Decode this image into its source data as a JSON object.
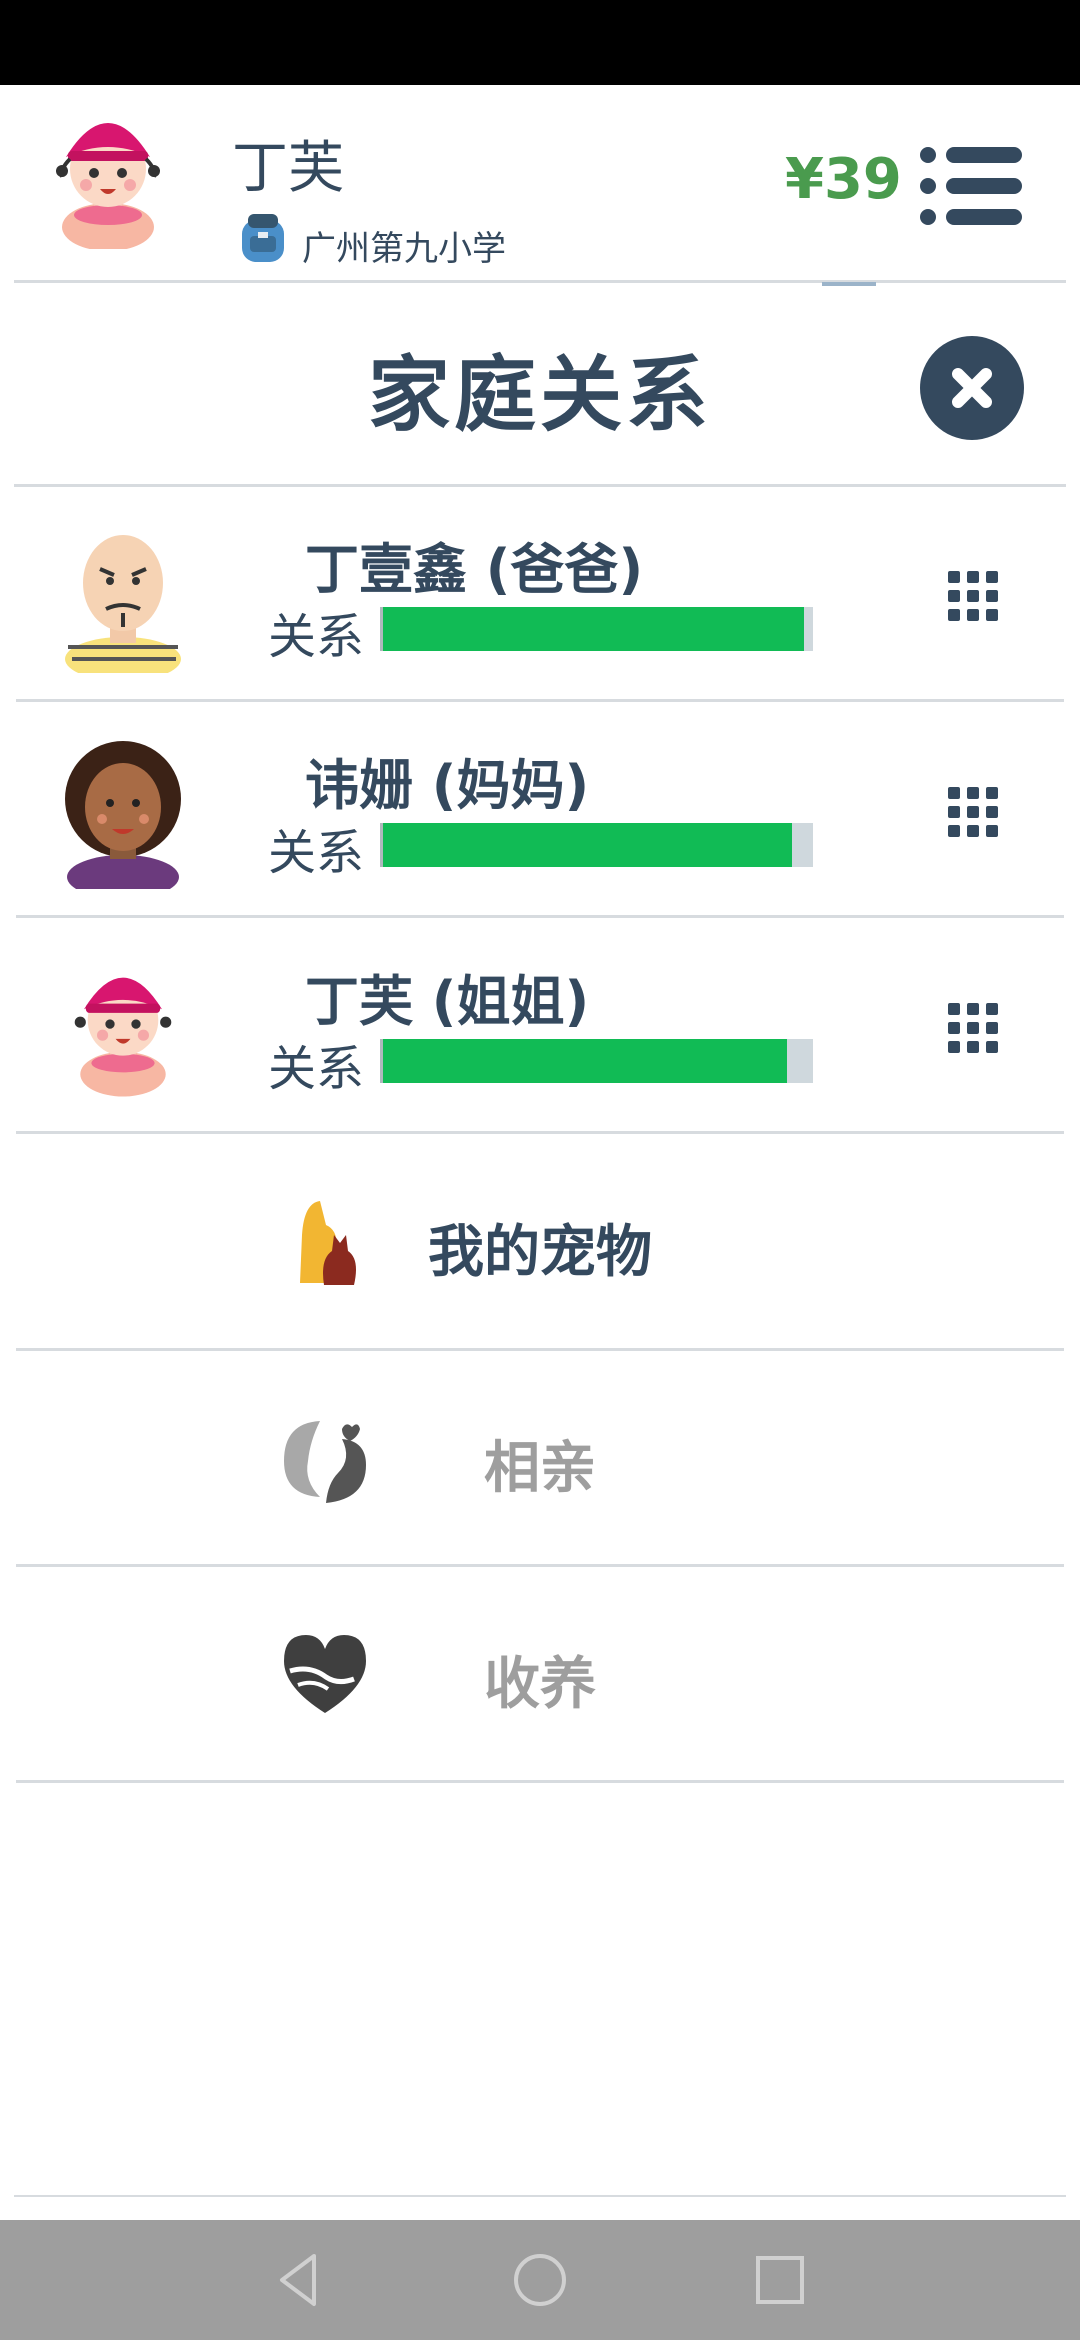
{
  "header": {
    "user_name": "丁芙",
    "school": "广州第九小学",
    "balance": "¥39"
  },
  "panel": {
    "title": "家庭关系"
  },
  "relation_label": "关系",
  "members": [
    {
      "name": "丁壹鑫 (爸爸)",
      "relation_level": 0.98,
      "avatar": "father-avatar"
    },
    {
      "name": "讳姗 (妈妈)",
      "relation_level": 0.95,
      "avatar": "mother-avatar"
    },
    {
      "name": "丁芙 (姐姐)",
      "relation_level": 0.94,
      "avatar": "sister-avatar"
    }
  ],
  "features": [
    {
      "label": "我的宠物",
      "enabled": true,
      "icon": "pet-icon"
    },
    {
      "label": "相亲",
      "enabled": false,
      "icon": "dating-icon"
    },
    {
      "label": "收养",
      "enabled": false,
      "icon": "adoption-icon"
    }
  ],
  "colors": {
    "primary": "#34495e",
    "balance": "#4a9b4e",
    "bar_fill": "#11bb55",
    "disabled_text": "#9e9e9e"
  }
}
